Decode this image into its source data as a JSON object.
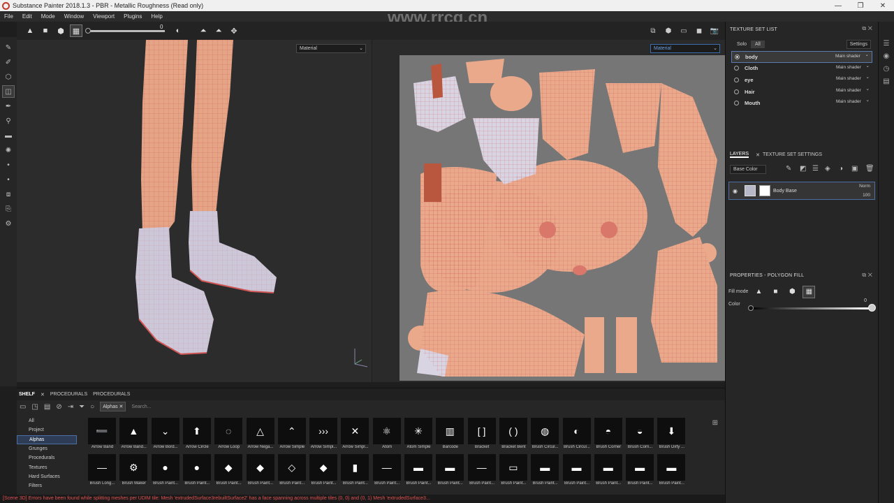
{
  "titlebar": {
    "title": "Substance Painter 2018.1.3 - PBR - Metallic Roughness (Read only)"
  },
  "menu": [
    "File",
    "Edit",
    "Mode",
    "Window",
    "Viewport",
    "Plugins",
    "Help"
  ],
  "viewport": {
    "symmetry_value": "0",
    "left_dropdown": "Material",
    "right_dropdown": "Material"
  },
  "texture_set_list": {
    "title": "TEXTURE SET LIST",
    "tab_solo": "Solo",
    "tab_all": "All",
    "settings": "Settings",
    "sets": [
      {
        "name": "body",
        "shader": "Main shader"
      },
      {
        "name": "Cloth",
        "shader": "Main shader"
      },
      {
        "name": "eye",
        "shader": "Main shader"
      },
      {
        "name": "Hair",
        "shader": "Main shader"
      },
      {
        "name": "Mouth",
        "shader": "Main shader"
      }
    ]
  },
  "layers": {
    "tab_layers": "LAYERS",
    "tab_settings": "TEXTURE SET SETTINGS",
    "channel": "Base Color",
    "layer_name": "Body Base",
    "blend": "Norm",
    "opacity": "100"
  },
  "properties": {
    "title": "PROPERTIES - POLYGON FILL",
    "fill_mode_label": "Fill mode",
    "color_label": "Color",
    "color_value": "0"
  },
  "shelf": {
    "tabs": [
      "SHELF",
      "PROCEDURALS",
      "PROCEDURALS"
    ],
    "filter_chip": "Alphas",
    "search_placeholder": "Search...",
    "categories": [
      "All",
      "Project",
      "Alphas",
      "Grunges",
      "Procedurals",
      "Textures",
      "Hard Surfaces",
      "Filters"
    ],
    "row1": [
      "Arrow Band",
      "Arrow Band...",
      "Arrow Bord...",
      "Arrow Circle",
      "Arrow Loop",
      "Arrow Nega...",
      "Arrow Simple",
      "Arrow Simpl...",
      "Arrow Simpl...",
      "Atom",
      "Atom Simple",
      "Barcode",
      "Bracket",
      "Bracket Bent",
      "Brush Circul...",
      "Brush Circul...",
      "Brush Corner",
      "Brush Corn...",
      "Brush Dirty ..."
    ],
    "row2": [
      "Brush Long...",
      "Brush Maker",
      "Brush Paint...",
      "Brush Paint...",
      "Brush Paint...",
      "Brush Paint...",
      "Brush Paint...",
      "Brush Paint...",
      "Brush Paint...",
      "Brush Paint...",
      "Brush Paint...",
      "Brush Paint...",
      "Brush Paint...",
      "Brush Paint...",
      "Brush Paint...",
      "Brush Paint...",
      "Brush Paint...",
      "Brush Paint...",
      "Brush Paint..."
    ]
  },
  "status": "[Scene 3D] Errors have been found while splitting meshes per UDIM tile: Mesh 'extrudedSurface3rebuiltSurface2' has a face spanning across multiple tiles (0, 0) and (0, 1) Mesh 'extrudedSurface3...",
  "watermark": "www.rrcg.cn",
  "colors": {
    "skin": "#e9a98a",
    "wire": "#c8504f",
    "sock": "#c9c5d8",
    "selection": "#4c6fa5",
    "error": "#e05050"
  }
}
